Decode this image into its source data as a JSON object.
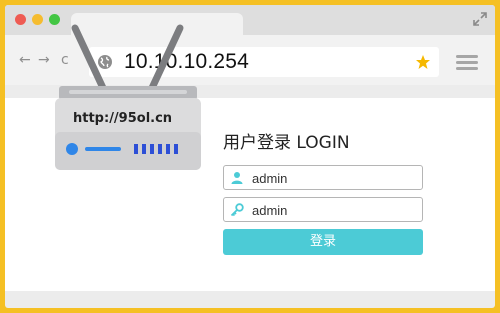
{
  "browser": {
    "address": "10.10.10.254",
    "nav": {
      "back": "←",
      "forward": "→",
      "reload": "c"
    }
  },
  "router": {
    "label": "http://95ol.cn"
  },
  "login": {
    "title": "用户登录 LOGIN",
    "username_value": "admin",
    "password_value": "admin",
    "submit_label": "登录"
  },
  "colors": {
    "frame": "#f5c024",
    "accent_button": "#4ccbd6",
    "star": "#f5b800"
  },
  "icons": {
    "globe": "globe-icon",
    "star": "star-icon",
    "menu": "menu-icon",
    "user": "user-icon",
    "key": "key-icon",
    "expand": "expand-icon"
  }
}
